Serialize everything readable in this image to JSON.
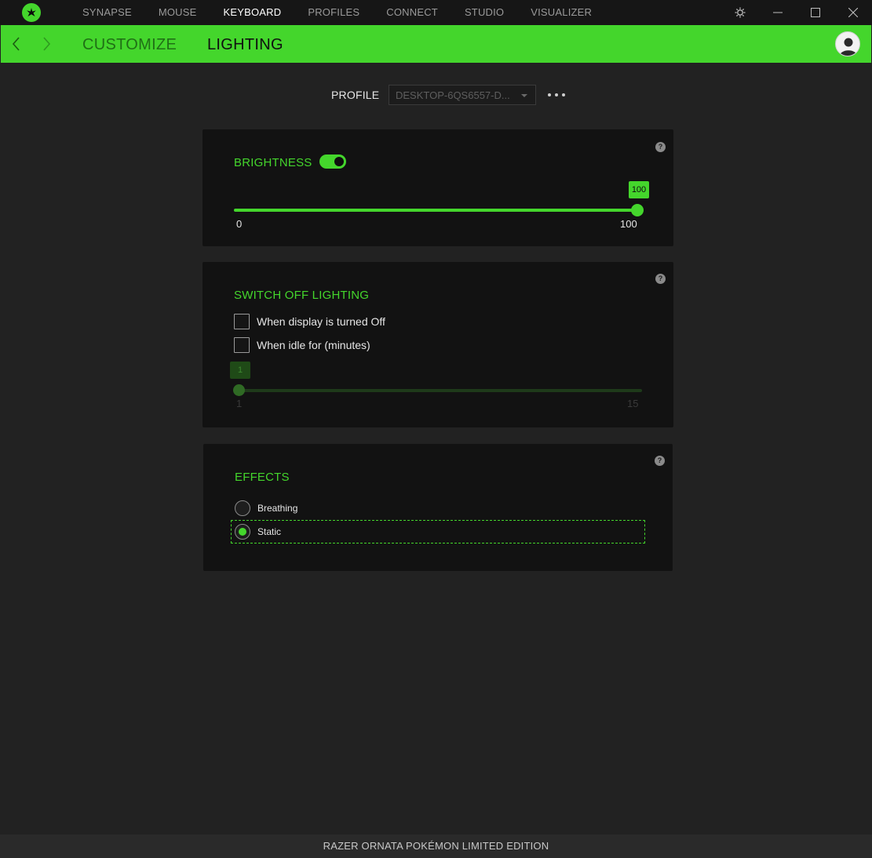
{
  "app": {
    "nav": [
      "SYNAPSE",
      "MOUSE",
      "KEYBOARD",
      "PROFILES",
      "CONNECT",
      "STUDIO",
      "VISUALIZER"
    ],
    "active_nav": "KEYBOARD",
    "icons": [
      "razer-logo-icon",
      "settings-gear-icon",
      "minimize-icon",
      "maximize-icon",
      "close-icon"
    ]
  },
  "subheader": {
    "tabs": [
      "CUSTOMIZE",
      "LIGHTING"
    ],
    "active_tab": "LIGHTING"
  },
  "profile": {
    "label": "PROFILE",
    "value": "DESKTOP-6QS6557-D..."
  },
  "brightness": {
    "title": "BRIGHTNESS",
    "enabled": true,
    "value": 100,
    "value_label": "100",
    "min_label": "0",
    "max_label": "100",
    "help": "?"
  },
  "switch_off": {
    "title": "SWITCH OFF LIGHTING",
    "options": [
      "When display is turned Off",
      "When idle for (minutes)"
    ],
    "checked": [
      false,
      false
    ],
    "idle_value": 1,
    "idle_value_label": "1",
    "idle_min_label": "1",
    "idle_max_label": "15",
    "help": "?"
  },
  "effects": {
    "title": "EFFECTS",
    "options": [
      "Breathing",
      "Static"
    ],
    "selected": "Static",
    "help": "?"
  },
  "footer": {
    "device": "RAZER ORNATA POKÉMON LIMITED EDITION"
  },
  "colors": {
    "accent": "#44d62c",
    "background": "#222222",
    "panel": "#121212",
    "titlebar": "#161616"
  }
}
